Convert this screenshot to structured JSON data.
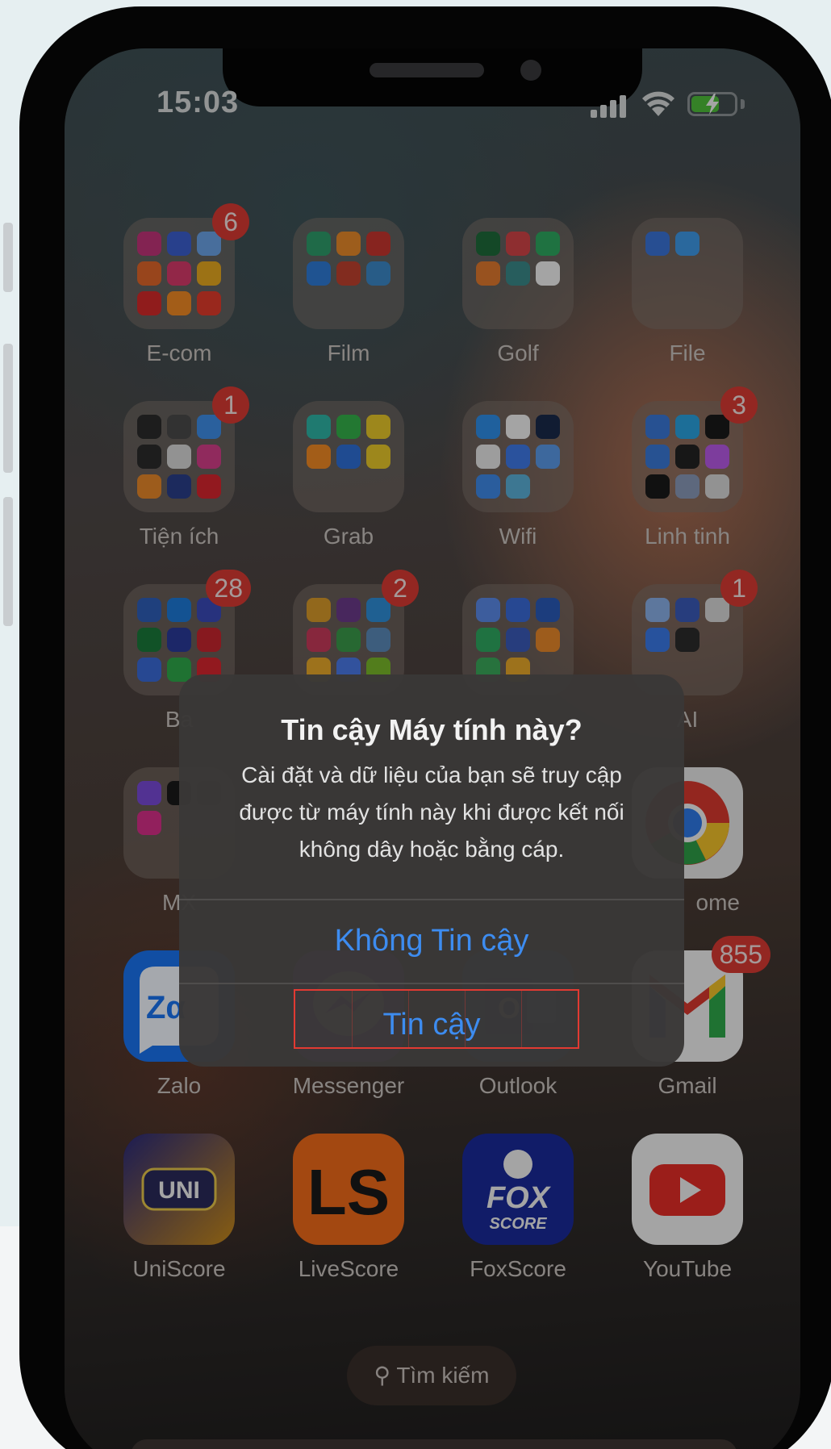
{
  "status_bar": {
    "time": "15:03"
  },
  "folders": [
    {
      "label": "E-com",
      "badge": "6",
      "minis": [
        "#c2347a",
        "#3b5fcf",
        "#6ba2e6",
        "#e0662a",
        "#d83a6a",
        "#e6a920",
        "#d42a2a",
        "#f08a24",
        "#e23c2c"
      ]
    },
    {
      "label": "Film",
      "badge": "",
      "minis": [
        "#2e9c6a",
        "#e8892a",
        "#c8362e",
        "#2f7bd6",
        "#c0412f",
        "#3b88c8"
      ]
    },
    {
      "label": "Golf",
      "badge": "",
      "minis": [
        "#1e6b3a",
        "#d24448",
        "#2fa860",
        "#e07a2e",
        "#3a8a8a",
        "#f2f2f2"
      ]
    },
    {
      "label": "File",
      "badge": "",
      "minis": [
        "#3a74d8",
        "#3f9ae8"
      ]
    },
    {
      "label": "Tiện ích",
      "badge": "1",
      "minis": [
        "#2b2b2b",
        "#4a4a4a",
        "#3e8ee8",
        "#2b2b2b",
        "#d8d8d8",
        "#d43e8a",
        "#e8882a",
        "#2a3f8a",
        "#d8262e"
      ]
    },
    {
      "label": "Grab",
      "badge": "",
      "minis": [
        "#2fb4a6",
        "#34b24a",
        "#e8c82a",
        "#f08a24",
        "#2f6fd6",
        "#e8c82a"
      ]
    },
    {
      "label": "Wifi",
      "badge": "",
      "minis": [
        "#2f8ee8",
        "#f2f2f2",
        "#1a2a4a",
        "#e8e8e8",
        "#3f7ae8",
        "#5a9ae8",
        "#3f8ae8",
        "#5ab0d8"
      ]
    },
    {
      "label": "Linh tinh",
      "badge": "3",
      "minis": [
        "#3a78d8",
        "#2aa2e0",
        "#1a1a1a",
        "#3a7ad8",
        "#222222",
        "#b85ae8",
        "#1a1a1a",
        "#8a9ab8",
        "#d8d8d8"
      ]
    },
    {
      "label": "Ba",
      "badge": "28",
      "minis": [
        "#2f5fb8",
        "#1c7ad8",
        "#3a4ab8",
        "#1a7a3a",
        "#2a3a9a",
        "#c8262e",
        "#3a6ad8",
        "#2fa84a",
        "#d8262e"
      ]
    },
    {
      "label": "",
      "badge": "2",
      "minis": [
        "#d89a2a",
        "#6a3a8a",
        "#2f8ed8",
        "#c83a5a",
        "#3a9a4a",
        "#5a8ab8",
        "#e8a82a",
        "#4a7ae8",
        "#7ab82a"
      ]
    },
    {
      "label": "",
      "badge": "",
      "minis": [
        "#5a8ae8",
        "#3a6ad8",
        "#2a5ab8",
        "#2fa860",
        "#3a5ab8",
        "#e8882a",
        "#3aa85a",
        "#e8a82a"
      ]
    },
    {
      "label": "AI",
      "badge": "1",
      "minis": [
        "#8ab0e8",
        "#3a5ab8",
        "#d8d8d8",
        "#3a7ae8",
        "#2b2b2b"
      ]
    },
    {
      "label": "MX",
      "badge": "",
      "minis": [
        "#7a4ad8",
        "#1a1a1a",
        "#2b2b2b",
        "#d8308a"
      ]
    }
  ],
  "apps": [
    {
      "label": "Chrome",
      "visible_label": "ome",
      "badge": "",
      "color": "#e8e8e8"
    },
    {
      "label": "Zalo",
      "badge": "",
      "color": "#1a74f0",
      "glyph": "Zα"
    },
    {
      "label": "Messenger",
      "badge": "",
      "color": "#a23fe8"
    },
    {
      "label": "Outlook",
      "badge": "",
      "color": "#1a6fd0"
    },
    {
      "label": "Gmail",
      "badge": "855",
      "color": "#f2f2f2"
    },
    {
      "label": "UniScore",
      "badge": "",
      "color": "#1d1a4a",
      "glyph": "UNI"
    },
    {
      "label": "LiveScore",
      "badge": "",
      "color": "#f06a1a",
      "glyph": "LS"
    },
    {
      "label": "FoxScore",
      "badge": "",
      "color": "#1a2a9a",
      "glyph": "FOX",
      "glyph2": "SCORE"
    },
    {
      "label": "YouTube",
      "badge": "",
      "color": "#f2f2f2"
    }
  ],
  "search": {
    "label": "Tìm kiếm",
    "icon": "search-icon"
  },
  "alert": {
    "title": "Tin cậy Máy tính này?",
    "message": "Cài đặt và dữ liệu của bạn sẽ truy cập được từ máy tính này khi được kết nối không dây hoặc bằng cáp.",
    "dont_trust_label": "Không Tin cậy",
    "trust_label": "Tin cậy",
    "button_color": "#3d8cf0",
    "highlight_color": "#e23a32"
  }
}
